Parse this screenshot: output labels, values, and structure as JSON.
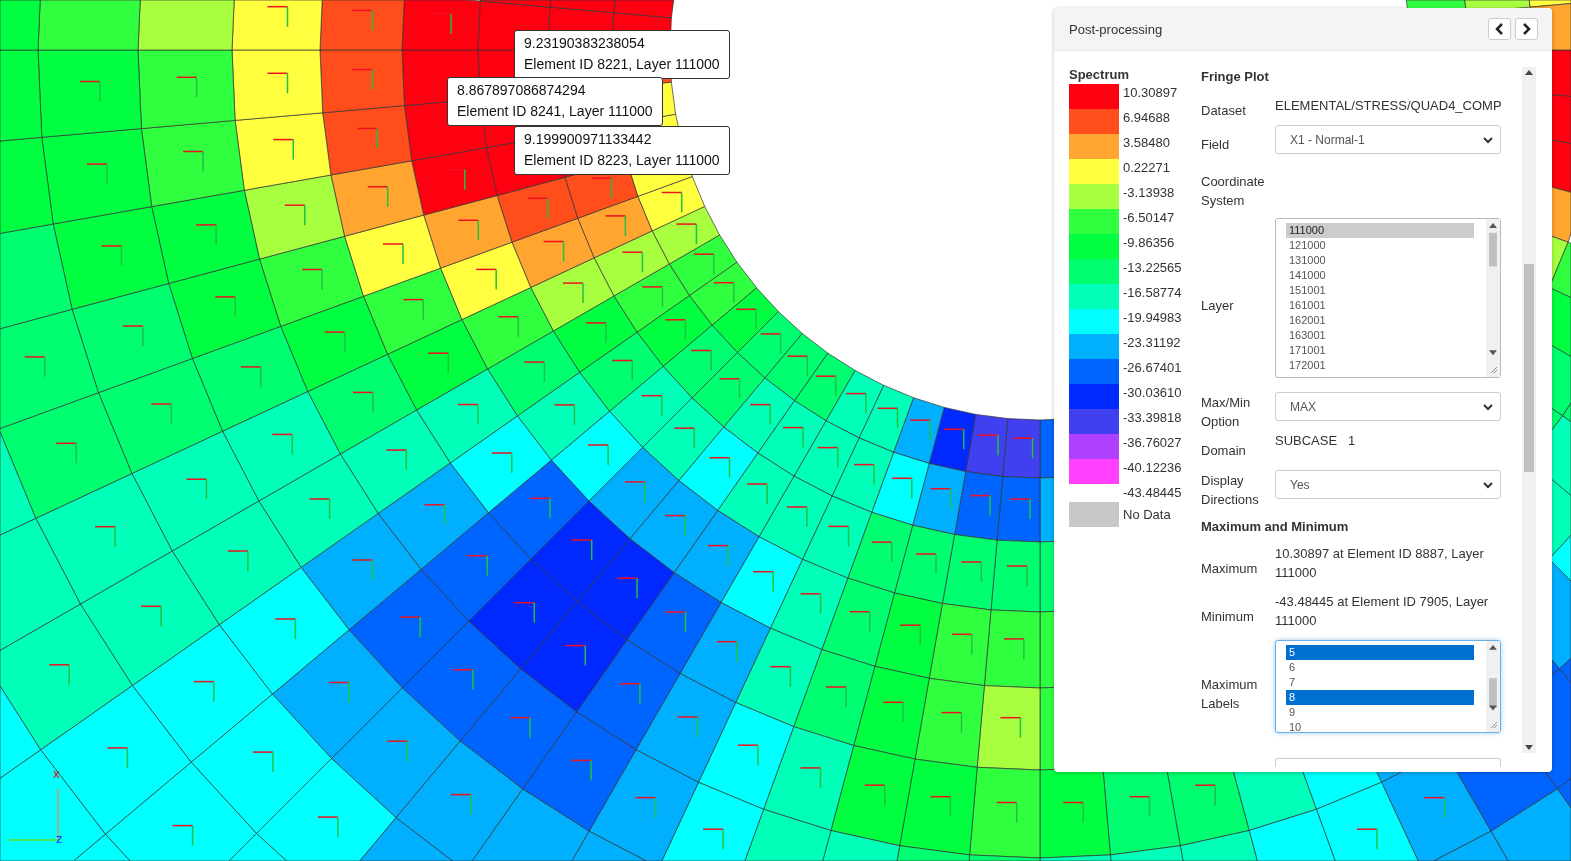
{
  "viewport": {
    "tooltips": [
      {
        "value": "9.23190383238054",
        "detail": "Element ID 8221, Layer 111000"
      },
      {
        "value": "8.867897086874294",
        "detail": "Element ID 8241, Layer 111000"
      },
      {
        "value": "9.199900971133442",
        "detail": "Element ID 8223, Layer 111000"
      }
    ],
    "axes": [
      {
        "kind": "x",
        "label": "x"
      },
      {
        "kind": "z",
        "label": "z"
      }
    ]
  },
  "panel": {
    "title": "Post-processing",
    "nav": [
      {
        "kind": "previous"
      },
      {
        "kind": "next"
      }
    ],
    "spectrum": {
      "title": "Spectrum",
      "bands": [
        {
          "color": "#ff0010",
          "label": "10.30897"
        },
        {
          "color": "#ff4d1c",
          "label": "6.94688"
        },
        {
          "color": "#ffa530",
          "label": "3.58480"
        },
        {
          "color": "#ffff40",
          "label": "0.22271"
        },
        {
          "color": "#a8ff40",
          "label": "-3.13938"
        },
        {
          "color": "#30ff40",
          "label": "-6.50147"
        },
        {
          "color": "#00ff40",
          "label": "-9.86356"
        },
        {
          "color": "#00ff70",
          "label": "-13.22565"
        },
        {
          "color": "#00ffb8",
          "label": "-16.58774"
        },
        {
          "color": "#00ffff",
          "label": "-19.94983"
        },
        {
          "color": "#00b0ff",
          "label": "-23.31192"
        },
        {
          "color": "#0064ff",
          "label": "-26.67401"
        },
        {
          "color": "#0028ff",
          "label": "-30.03610"
        },
        {
          "color": "#4040f0",
          "label": "-33.39818"
        },
        {
          "color": "#b040ff",
          "label": "-36.76027"
        },
        {
          "color": "#ff40ff",
          "label": "-40.12236"
        }
      ],
      "min_label": "-43.48445",
      "no_data": {
        "color": "#c8c8c8",
        "label": "No Data"
      }
    },
    "form": [
      {
        "kind": "heading",
        "text": "Fringe Plot"
      },
      {
        "kind": "text",
        "label": "Dataset",
        "value": "ELEMENTAL/STRESS/QUAD4_COMP"
      },
      {
        "kind": "select",
        "label": "Field",
        "value": "X1 - Normal-1"
      },
      {
        "kind": "empty",
        "label": "Coordinate System"
      },
      {
        "kind": "list",
        "label": "Layer",
        "focused": false,
        "items": [
          {
            "text": "111000",
            "selected": true
          },
          {
            "text": "121000",
            "selected": false
          },
          {
            "text": "131000",
            "selected": false
          },
          {
            "text": "141000",
            "selected": false
          },
          {
            "text": "151001",
            "selected": false
          },
          {
            "text": "161001",
            "selected": false
          },
          {
            "text": "162001",
            "selected": false
          },
          {
            "text": "163001",
            "selected": false
          },
          {
            "text": "171001",
            "selected": false
          },
          {
            "text": "172001",
            "selected": false
          }
        ]
      },
      {
        "kind": "select",
        "label": "Max/Min Option",
        "value": "MAX"
      },
      {
        "kind": "text",
        "label": "Domain",
        "value": "SUBCASE   1"
      },
      {
        "kind": "select",
        "label": "Display Directions",
        "value": "Yes"
      },
      {
        "kind": "heading",
        "text": "Maximum and Minimum"
      },
      {
        "kind": "text",
        "label": "Maximum",
        "value": "10.30897 at Element ID 8887, Layer 111000"
      },
      {
        "kind": "text",
        "label": "Minimum",
        "value": "-43.48445 at Element ID 7905, Layer 111000"
      },
      {
        "kind": "list",
        "label": "Maximum Labels",
        "focused": true,
        "items": [
          {
            "text": "5",
            "selected": true
          },
          {
            "text": "6",
            "selected": false
          },
          {
            "text": "7",
            "selected": false
          },
          {
            "text": "8",
            "selected": true
          },
          {
            "text": "9",
            "selected": false
          },
          {
            "text": "10",
            "selected": false
          }
        ]
      },
      {
        "kind": "cut"
      }
    ]
  }
}
